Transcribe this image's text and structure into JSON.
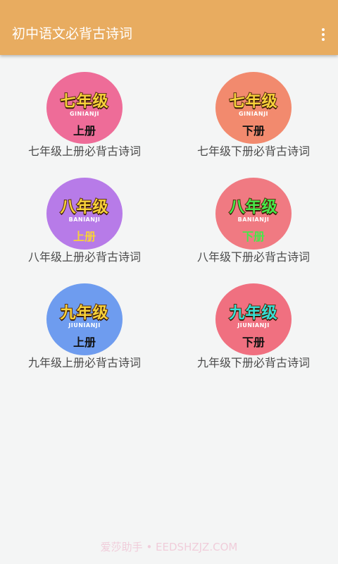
{
  "app": {
    "title": "初中语文必背古诗词"
  },
  "items": [
    {
      "big": "七年级",
      "pinyin": "GINIANJI",
      "vol": "上册",
      "caption": "七年级上册必背古诗词",
      "bg": "#ee6c98",
      "bigColor": "#f7d23a",
      "pinyinColor": "#ffffff",
      "volColor": "#111111"
    },
    {
      "big": "七年级",
      "pinyin": "GINIANJI",
      "vol": "下册",
      "caption": "七年级下册必背古诗词",
      "bg": "#f28a6e",
      "bigColor": "#f7d23a",
      "pinyinColor": "#ffffff",
      "volColor": "#111111"
    },
    {
      "big": "八年级",
      "pinyin": "BANIANJI",
      "vol": "上册",
      "caption": "八年级上册必背古诗词",
      "bg": "#b77be8",
      "bigColor": "#f7d23a",
      "pinyinColor": "#ffffff",
      "volColor": "#f7d23a"
    },
    {
      "big": "八年级",
      "pinyin": "BANIANJI",
      "vol": "下册",
      "caption": "八年级下册必背古诗词",
      "bg": "#f07a82",
      "bigColor": "#46e84a",
      "pinyinColor": "#ffffff",
      "volColor": "#46e84a"
    },
    {
      "big": "九年级",
      "pinyin": "JIUNIANJI",
      "vol": "上册",
      "caption": "九年级上册必背古诗词",
      "bg": "#6e9cef",
      "bigColor": "#f7d23a",
      "pinyinColor": "#ffffff",
      "volColor": "#111111"
    },
    {
      "big": "九年级",
      "pinyin": "JIUNIANJI",
      "vol": "下册",
      "caption": "九年级下册必背古诗词",
      "bg": "#f07080",
      "bigColor": "#36e0d6",
      "pinyinColor": "#ffffff",
      "volColor": "#111111"
    }
  ],
  "watermark": "爱莎助手 • EEDSHZJZ.COM"
}
